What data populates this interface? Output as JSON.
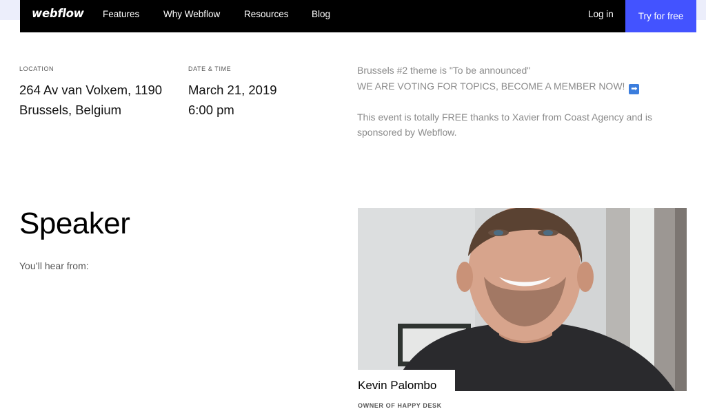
{
  "nav": {
    "logo": "webflow",
    "links": [
      "Features",
      "Why Webflow",
      "Resources",
      "Blog"
    ],
    "login": "Log in",
    "cta": "Try for free"
  },
  "event": {
    "location_label": "LOCATION",
    "location_line1": "264 Av van Volxem, 1190",
    "location_line2": "Brussels, Belgium",
    "datetime_label": "DATE & TIME",
    "date": "March 21, 2019",
    "time": "6:00 pm",
    "description_line1": "Brussels #2 theme is \"To be announced\"",
    "description_line2": "WE ARE VOTING FOR TOPICS, BECOME A MEMBER NOW!",
    "description_emoji": "➡",
    "description_line3": "This event is totally FREE thanks to Xavier from Coast Agency and is sponsored by Webflow."
  },
  "speaker_section": {
    "heading": "Speaker",
    "subheading": "You’ll hear from:",
    "name": "Kevin Palombo",
    "role": "OWNER OF HAPPY DESK"
  },
  "colors": {
    "nav_bg": "#000000",
    "cta_bg": "#4353ff",
    "muted_text": "#8a8a8a"
  },
  "icons": {
    "arrow": "right-arrow-emoji-icon"
  }
}
